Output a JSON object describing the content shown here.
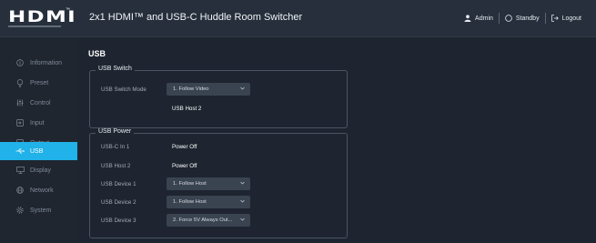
{
  "header": {
    "logo": "HDMI",
    "title": "2x1 HDMI™ and USB-C Huddle Room Switcher",
    "user_label": "Admin",
    "standby_label": "Standby",
    "logout_label": "Logout"
  },
  "sidebar": {
    "items": [
      {
        "label": "Information",
        "icon": "info-icon"
      },
      {
        "label": "Preset",
        "icon": "bulb-icon"
      },
      {
        "label": "Control",
        "icon": "sliders-icon"
      },
      {
        "label": "Input",
        "icon": "input-icon"
      },
      {
        "label": "Output",
        "icon": "output-icon"
      },
      {
        "label": "USB",
        "icon": "usb-icon",
        "active": true
      },
      {
        "label": "Display",
        "icon": "monitor-icon"
      },
      {
        "label": "Network",
        "icon": "globe-icon"
      },
      {
        "label": "System",
        "icon": "gear-icon"
      }
    ]
  },
  "main": {
    "page_title": "USB",
    "usb_switch": {
      "legend": "USB Switch",
      "mode_label": "USB Switch Mode",
      "mode_value": "1. Follow Video",
      "status": "USB Host 2"
    },
    "usb_power": {
      "legend": "USB Power",
      "rows": [
        {
          "label": "USB-C In 1",
          "value": "Power Off"
        },
        {
          "label": "USB Host 2",
          "value": "Power Off"
        },
        {
          "label": "USB Device 1",
          "value": "1. Follow Host"
        },
        {
          "label": "USB Device 2",
          "value": "1. Follow Host"
        },
        {
          "label": "USB Device 3",
          "value": "2. Force 5V Always Out..."
        }
      ]
    }
  },
  "colors": {
    "accent": "#20b2e8",
    "background": "#1e2530",
    "topbar": "#262f3b",
    "select": "#3a4350"
  }
}
